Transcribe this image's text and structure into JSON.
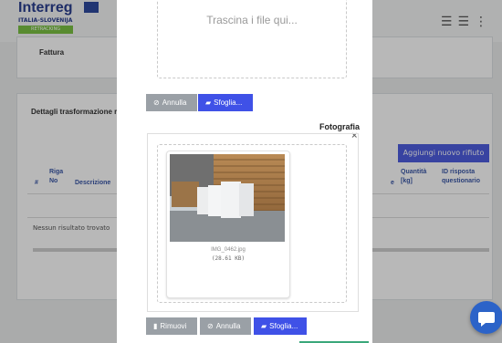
{
  "header": {
    "logo_title": "Interreg",
    "logo_subtitle": "ITALIA-SLOVENIJA",
    "logo_program": "RETRACKING",
    "menu_icons": [
      "list-icon",
      "menu-icon",
      "more-icon"
    ]
  },
  "background": {
    "card1_label": "Fattura",
    "card2_label": "Dettagli trasformazione r",
    "add_button": "Aggiungi nuovo rifiuto",
    "table": {
      "columns": [
        "#",
        "Riga No",
        "Descrizione",
        "e",
        "Quantità [kg]",
        "ID risposta questionario"
      ]
    },
    "empty_text": "Nessun risultato trovato"
  },
  "modal": {
    "dropzone_text": "Trascina i file qui...",
    "top_buttons": {
      "cancel": "Annulla",
      "browse": "Sfoglia..."
    },
    "section_title": "Fotografia",
    "close_symbol": "×",
    "file": {
      "name": "IMG_0462.jpg",
      "size": "(28.61 KB)"
    },
    "bottom_buttons": {
      "remove": "Rimuovi",
      "cancel": "Annulla",
      "browse": "Sfoglia..."
    }
  },
  "colors": {
    "primary": "#3f51e7",
    "secondary": "#9aa0a6",
    "chat": "#2c63c8",
    "accent_green": "#3aa87a"
  }
}
